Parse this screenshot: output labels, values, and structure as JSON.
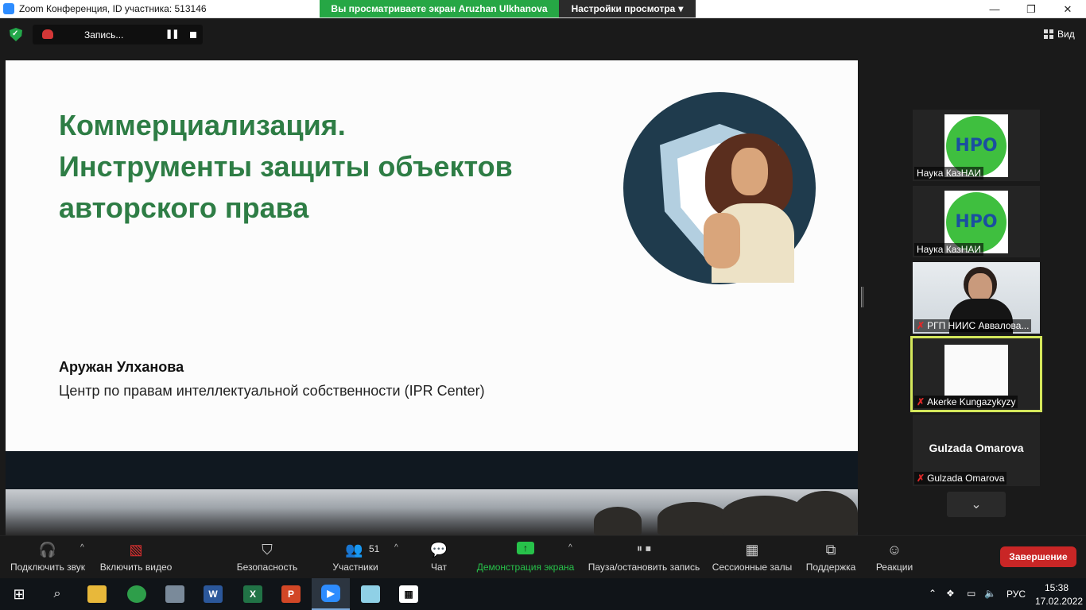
{
  "window": {
    "title": "Zoom Конференция, ID участника: 513146",
    "minimize": "—",
    "restore": "❐",
    "close": "✕"
  },
  "share_banner": {
    "text": "Вы просматриваете экран Aruzhan Ulkhanova",
    "view_settings": "Настройки просмотра"
  },
  "recording": {
    "label": "Запись...",
    "pause_glyph": "❚❚"
  },
  "view_button": {
    "label": "Вид"
  },
  "slide": {
    "title_lines": [
      "Коммерциализация.",
      "Инструменты защиты объектов",
      "авторского права"
    ],
    "author": "Аружан Улханова",
    "organization": "Центр по правам интеллектуальной собственности (IPR Center)"
  },
  "participants": [
    {
      "name": "Наука КазНАИ",
      "logo_text": "НРО",
      "muted": false
    },
    {
      "name": "Наука КазНАИ",
      "logo_text": "НРО",
      "muted": false
    },
    {
      "name": "РГП НИИС Аввалова...",
      "muted": true
    },
    {
      "name": "Akerke Kungazykyzy",
      "muted": true,
      "active": true
    },
    {
      "name": "Gulzada Omarova",
      "display_name": "Gulzada Omarova",
      "muted": true
    }
  ],
  "toolbar": {
    "audio": "Подключить звук",
    "video": "Включить видео",
    "security": "Безопасность",
    "participants": "Участники",
    "participants_count": "51",
    "chat": "Чат",
    "share": "Демонстрация экрана",
    "record": "Пауза/остановить запись",
    "breakout": "Сессионные залы",
    "support": "Поддержка",
    "reactions": "Реакции",
    "end": "Завершение"
  },
  "taskbar": {
    "language": "РУС",
    "time": "15:38",
    "date": "17.02.2022"
  },
  "colors": {
    "share_banner": "#26a745",
    "slide_title": "#2e7d45",
    "end_button": "#c92626",
    "active_speaker": "#d4e75b"
  }
}
